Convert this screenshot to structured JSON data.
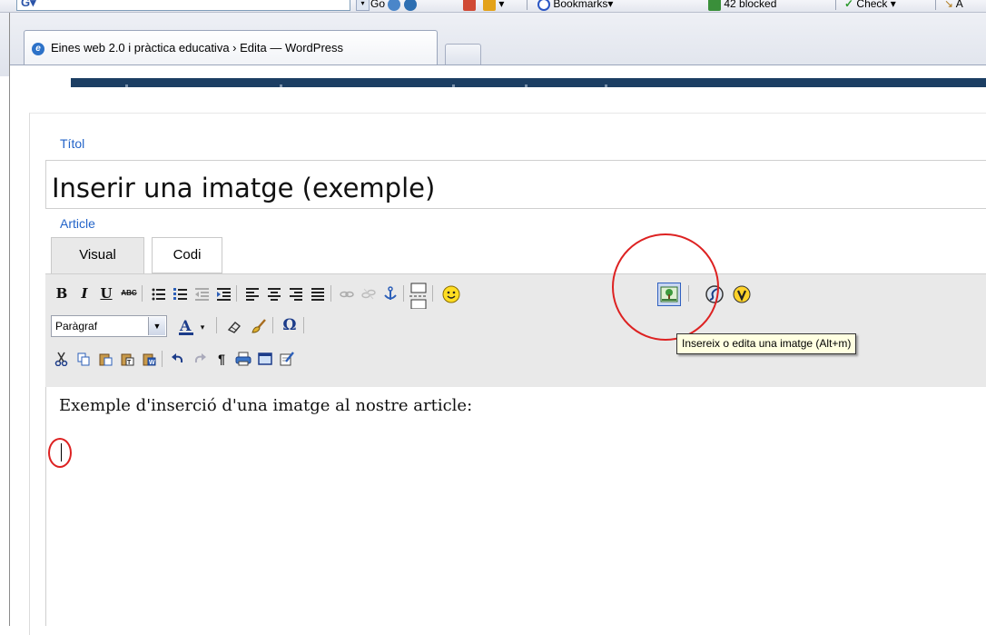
{
  "browser": {
    "toolbar": {
      "search_logo": "G",
      "go_label": "Go",
      "bookmarks_label": "Bookmarks",
      "blocked_label": "42 blocked",
      "check_label": "Check",
      "autolink_label": "A"
    },
    "tabs": [
      {
        "title": "Eines web 2.0 i pràctica educativa › Edita — WordPress",
        "icon": "ie-page-icon"
      }
    ]
  },
  "editor": {
    "title_label": "Títol",
    "title_value": "Inserir una imatge (exemple)",
    "article_label": "Article",
    "tabs": {
      "visual": "Visual",
      "code": "Codi"
    },
    "format_select_value": "Paràgraf",
    "tooltip": "Insereix o edita una imatge (Alt+m)",
    "content_text": "Exemple d'inserció d'una imatge al nostre article:",
    "toolbar_row1": [
      "bold",
      "italic",
      "underline",
      "strikethrough",
      "bullet-list",
      "numbered-list",
      "outdent",
      "indent",
      "align-left",
      "align-center",
      "align-right",
      "align-justify",
      "link",
      "unlink",
      "anchor",
      "more",
      "smiley",
      "image",
      "flash",
      "video"
    ],
    "toolbar_row2": [
      "format-select",
      "text-color",
      "remove-format",
      "clean-up",
      "special-character"
    ],
    "toolbar_row3": [
      "cut",
      "copy",
      "paste",
      "paste-text",
      "paste-word",
      "undo",
      "redo",
      "paragraph-marks",
      "print",
      "fullscreen",
      "edit-html"
    ],
    "colors": {
      "link_label": "#2364c9",
      "annotation": "#dd2222",
      "tooltip_bg": "#ffffe1",
      "nav_bar": "#1c3e63"
    },
    "glyphs": {
      "bold": "B",
      "italic": "I",
      "underline": "U",
      "strike": "ABC",
      "omega": "Ω",
      "pilcrow": "¶"
    }
  }
}
